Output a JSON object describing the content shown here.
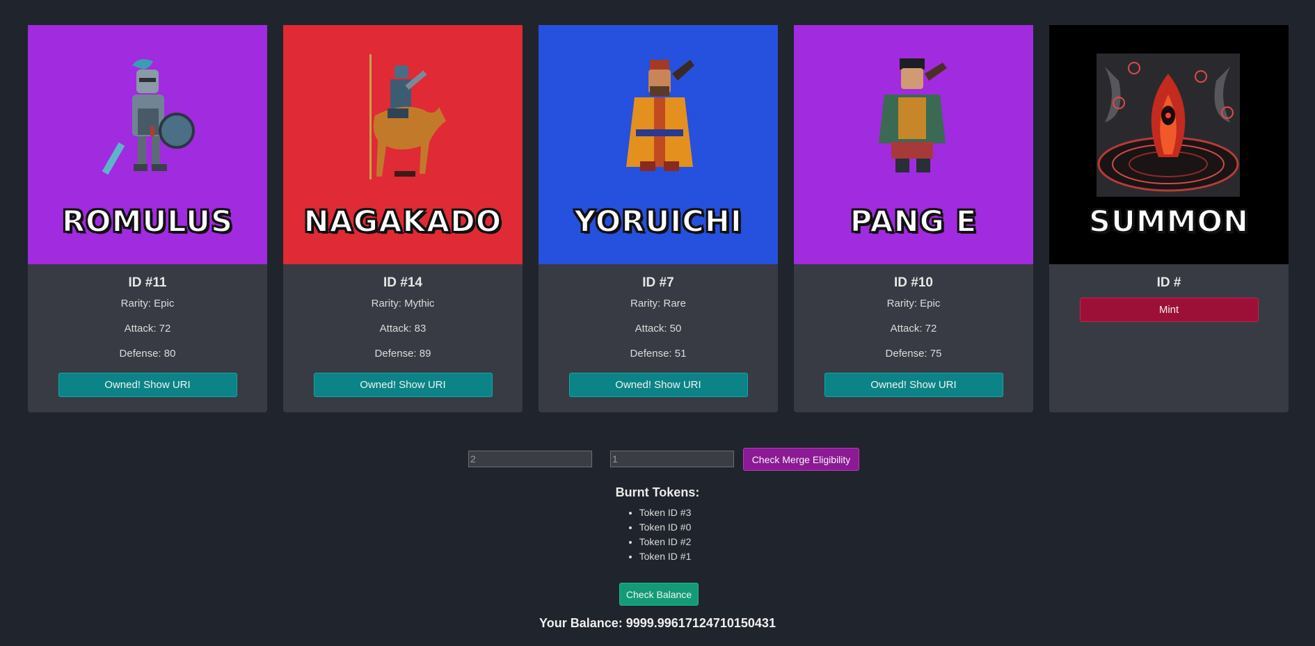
{
  "cards": [
    {
      "name": "ROMULUS",
      "id": "ID #11",
      "rarity": "Rarity: Epic",
      "attack": "Attack: 72",
      "defense": "Defense: 80",
      "button": "Owned! Show URI",
      "bg": "#a12bdf"
    },
    {
      "name": "NAGAKADO",
      "id": "ID #14",
      "rarity": "Rarity: Mythic",
      "attack": "Attack: 83",
      "defense": "Defense: 89",
      "button": "Owned! Show URI",
      "bg": "#e02a36"
    },
    {
      "name": "YORUICHI",
      "id": "ID #7",
      "rarity": "Rarity: Rare",
      "attack": "Attack: 50",
      "defense": "Defense: 51",
      "button": "Owned! Show URI",
      "bg": "#2650de"
    },
    {
      "name": "PANG E",
      "id": "ID #10",
      "rarity": "Rarity: Epic",
      "attack": "Attack: 72",
      "defense": "Defense: 75",
      "button": "Owned! Show URI",
      "bg": "#a12bdf"
    }
  ],
  "summon": {
    "name": "SUMMON",
    "id": "ID #",
    "button": "Mint",
    "bg": "#000000"
  },
  "merge": {
    "input1_value": "2",
    "input2_value": "1",
    "button": "Check Merge Eligibility"
  },
  "burnt": {
    "title": "Burnt Tokens:",
    "items": [
      "Token ID #3",
      "Token ID #0",
      "Token ID #2",
      "Token ID #1"
    ]
  },
  "balance": {
    "button": "Check Balance",
    "text": "Your Balance: 9999.99617124710150431"
  }
}
